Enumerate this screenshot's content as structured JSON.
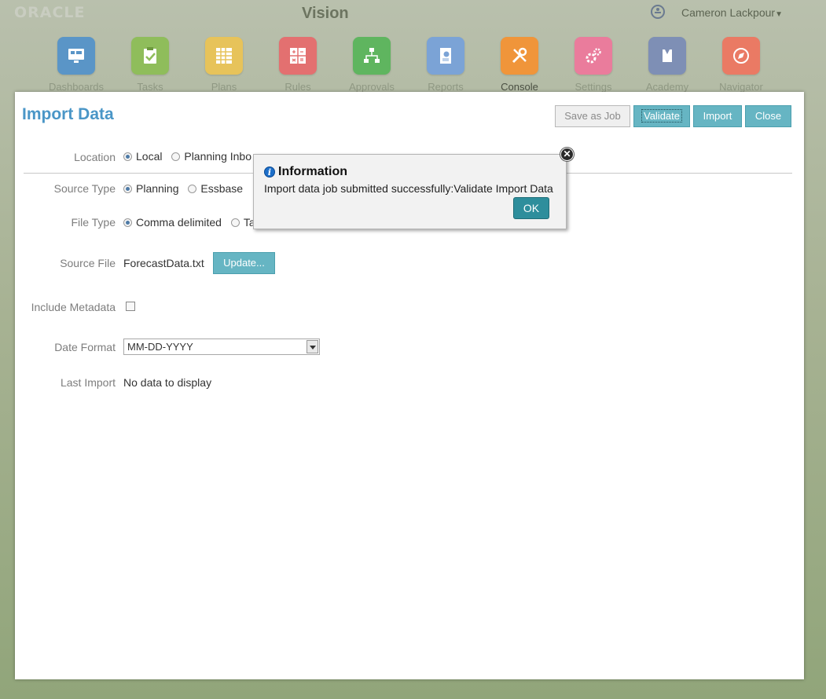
{
  "header": {
    "logo": "ORACLE",
    "app_name": "Vision",
    "user_name": "Cameron Lackpour"
  },
  "nav": [
    {
      "label": "Dashboards",
      "icon": "dashboard-icon",
      "color": "#5a95c7"
    },
    {
      "label": "Tasks",
      "icon": "clipboard-check-icon",
      "color": "#8fbd5b"
    },
    {
      "label": "Plans",
      "icon": "grid-icon",
      "color": "#e7c35a"
    },
    {
      "label": "Rules",
      "icon": "calculator-icon",
      "color": "#e37070"
    },
    {
      "label": "Approvals",
      "icon": "hierarchy-icon",
      "color": "#5fb55f"
    },
    {
      "label": "Reports",
      "icon": "report-icon",
      "color": "#7ba3d6"
    },
    {
      "label": "Console",
      "icon": "tools-icon",
      "color": "#f0953a"
    },
    {
      "label": "Settings",
      "icon": "gears-icon",
      "color": "#ea7c9c"
    },
    {
      "label": "Academy",
      "icon": "graduate-icon",
      "color": "#7e8fb5"
    },
    {
      "label": "Navigator",
      "icon": "compass-icon",
      "color": "#ea7a64"
    }
  ],
  "panel": {
    "title": "Import Data",
    "buttons": {
      "save_as_job": "Save as Job",
      "validate": "Validate",
      "import": "Import",
      "close": "Close"
    },
    "form": {
      "location": {
        "label": "Location",
        "options": [
          "Local",
          "Planning Inbo"
        ],
        "selected": "Local"
      },
      "source_type": {
        "label": "Source Type",
        "options": [
          "Planning",
          "Essbase"
        ],
        "selected": "Planning"
      },
      "file_type": {
        "label": "File Type",
        "options": [
          "Comma delimited",
          "Ta"
        ],
        "selected": "Comma delimited"
      },
      "source_file": {
        "label": "Source File",
        "value": "ForecastData.txt",
        "button": "Update..."
      },
      "include_metadata": {
        "label": "Include Metadata",
        "checked": false
      },
      "date_format": {
        "label": "Date Format",
        "value": "MM-DD-YYYY"
      },
      "last_import": {
        "label": "Last Import",
        "value": "No data to display"
      }
    }
  },
  "dialog": {
    "title": "Information",
    "message": "Import data job submitted successfully:Validate Import Data",
    "ok": "OK"
  }
}
